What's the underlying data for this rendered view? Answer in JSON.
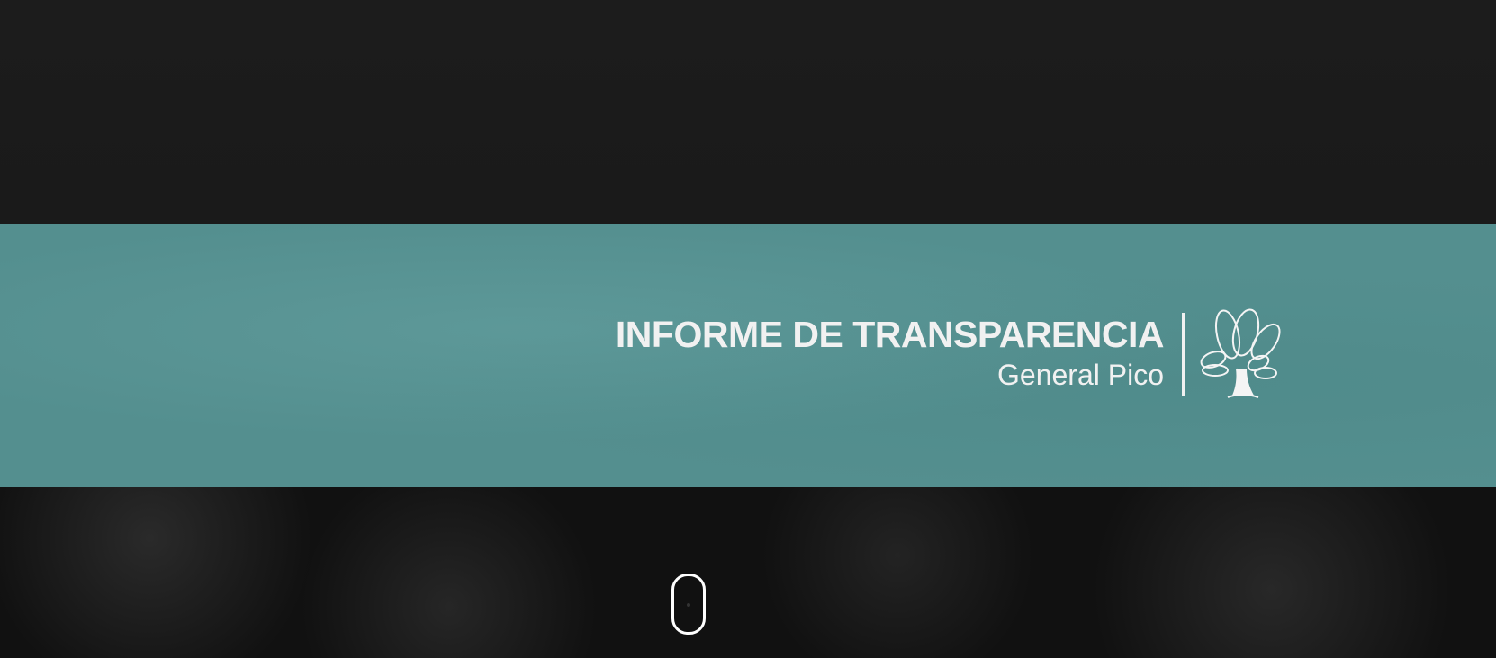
{
  "header": {
    "title": "INFORME DE TRANSPARENCIA",
    "subtitle": "General Pico",
    "logo_icon": "tree-icon"
  },
  "scroll_indicator": {
    "icon": "mouse-scroll-icon"
  },
  "colors": {
    "band": "#548f8f",
    "background": "#1b1b1b",
    "text": "#f1f1f1"
  }
}
